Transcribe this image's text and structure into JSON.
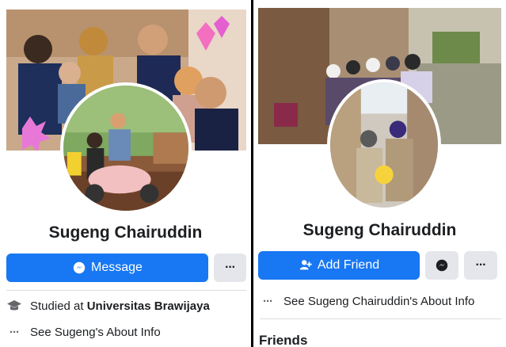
{
  "left": {
    "profile_name": "Sugeng Chairuddin",
    "message_button": "Message",
    "more_button": "···",
    "studied_prefix": "Studied at ",
    "studied_school": "Universitas Brawijaya",
    "about_link": "See Sugeng's About Info",
    "about_dots": "···"
  },
  "right": {
    "profile_name": "Sugeng Chairuddin",
    "add_friend_button": "Add Friend",
    "more_button": "···",
    "about_link": "See Sugeng Chairuddin's About Info",
    "about_dots": "···",
    "friends_title": "Friends"
  },
  "colors": {
    "fb_blue": "#1877f2",
    "button_grey": "#e4e6eb",
    "label_red": "#e3221c"
  },
  "icons": [
    "messenger-icon",
    "add-friend-icon",
    "graduation-cap-icon",
    "ellipsis-icon"
  ]
}
